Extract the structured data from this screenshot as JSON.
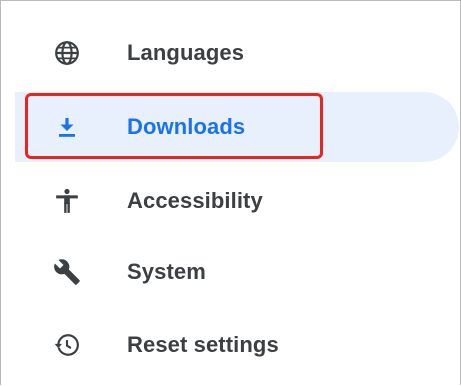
{
  "nav": {
    "items": [
      {
        "label": "Languages",
        "icon": "globe-icon",
        "selected": false
      },
      {
        "label": "Downloads",
        "icon": "download-icon",
        "selected": true
      },
      {
        "label": "Accessibility",
        "icon": "accessibility-icon",
        "selected": false
      },
      {
        "label": "System",
        "icon": "wrench-icon",
        "selected": false
      },
      {
        "label": "Reset settings",
        "icon": "reset-history-icon",
        "selected": false
      }
    ]
  },
  "colors": {
    "text": "#3c4043",
    "accent": "#1a73e8",
    "selected_bg": "#e8f0fe",
    "highlight_border": "#e8261d"
  }
}
